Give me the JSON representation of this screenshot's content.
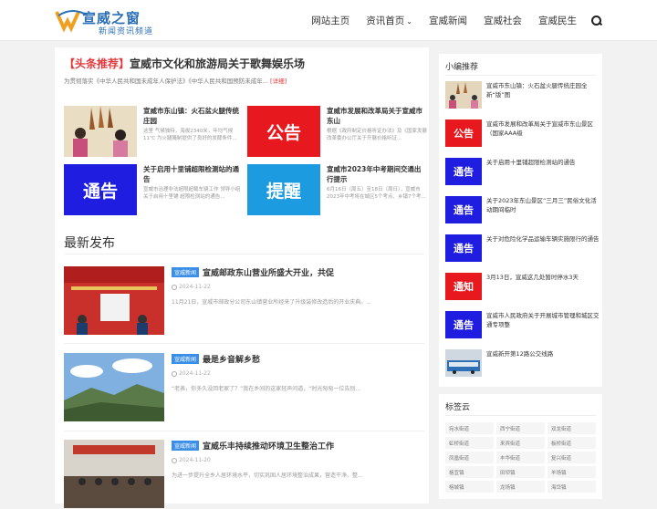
{
  "brand": {
    "name": "宣威之窗",
    "tagline": "新闻资讯频道",
    "accent": "#2b6fb6"
  },
  "nav": {
    "items": [
      "网站主页",
      "资讯首页",
      "宣威新闻",
      "宣威社会",
      "宣威民生"
    ],
    "caret": "⌄"
  },
  "headline": {
    "tag": "【头条推荐】",
    "title": "宣威市文化和旅游局关于歌舞娱乐场",
    "desc": "为贯彻落实《中华人民共和国未成年人保护法》《中华人民共和国预防未成年...",
    "more": "[详细]"
  },
  "cards": [
    {
      "title": "宣威市东山镇：火石盆火腿传统庄园",
      "desc": "这里 气候独特，海拔2340米，年均气候11℃ 为火腿腌制提供了良好的发酵条件...",
      "thumb": "",
      "thumb_color": "#d9c4a0"
    },
    {
      "title": "宣威市发展和改革局关于宣威市东山",
      "desc": "根据《政府制定价格听证办法》及《国家发展改革委办公厅关于开展价格听证...",
      "thumb": "公告",
      "thumb_color": "#e8191e"
    },
    {
      "title": "关于启用十里铺超限检测站的通告",
      "desc": "宣威市治理非法超限超载车辆工作 领导小组关于启用十里铺 超限检测站的通告...",
      "thumb": "通告",
      "thumb_color": "#1f1ee0"
    },
    {
      "title": "宣威市2023年中考期间交通出行提示",
      "desc": "6月16日（周五）至18日（周日），宣威市2023年中考将在城区5个考点、乡镇7个考...",
      "thumb": "提醒",
      "thumb_color": "#1c9be0"
    }
  ],
  "latest": {
    "title": "最新发布"
  },
  "posts": [
    {
      "cat": "宣威新闻",
      "title": "宣威邮政东山营业所盛大开业，共促",
      "date": "2024-11-22",
      "desc": "11月21日，宣威市邮政分公司东山镇营业所经来了升级装修改造后的开业庆典。..."
    },
    {
      "cat": "宣威新闻",
      "title": "最是乡音解乡愁",
      "date": "2024-11-22",
      "desc": "“老表，你多久没回老家了？”我在乡间的这家轻声问道，“时光匆匆一位告别..."
    },
    {
      "cat": "宣威新闻",
      "title": "宣威乐丰持续推动环境卫生整治工作",
      "date": "2024-11-20",
      "desc": "为进一步提升全乡人居环境水平，切实巩固人居环境整治成果，营造干净、整..."
    }
  ],
  "sidebar": {
    "title": "小编推荐",
    "items": [
      {
        "text": "宣威市东山镇：火石盆火腿传统庄园全新“版”图",
        "thumb": "",
        "color": "#c9b48a"
      },
      {
        "text": "宣威市发展和改革局关于宣威市东山景区（国家AAA级",
        "thumb": "公告",
        "color": "#e8191e"
      },
      {
        "text": "关于启用十里铺超限检测站的通告",
        "thumb": "通告",
        "color": "#1f1ee0"
      },
      {
        "text": "关于2023年东山景区“三月三”民俗文化活动期间临时",
        "thumb": "通告",
        "color": "#1f1ee0"
      },
      {
        "text": "关于对危险化学品运输车辆实施限行的通告",
        "thumb": "通告",
        "color": "#1f1ee0"
      },
      {
        "text": "3月13日，宣威这几处暂时停水3天",
        "thumb": "通知",
        "color": "#e8191e"
      },
      {
        "text": "宣威市人民政府关于开展城市管理和城区交通专项整",
        "thumb": "通告",
        "color": "#1f1ee0"
      },
      {
        "text": "宣威新开第12路公交线路",
        "thumb": "",
        "color": "#8a9aa8"
      }
    ]
  },
  "tagcloud": {
    "title": "标签云",
    "tags": [
      "宛水街道",
      "西宁街道",
      "双龙街道",
      "虹桥街道",
      "来宾街道",
      "板桥街道",
      "凤凰街道",
      "丰华街道",
      "复兴街道",
      "格宜镇",
      "田坝镇",
      "羊场镇",
      "榕城镇",
      "龙场镇",
      "海岱镇"
    ]
  }
}
